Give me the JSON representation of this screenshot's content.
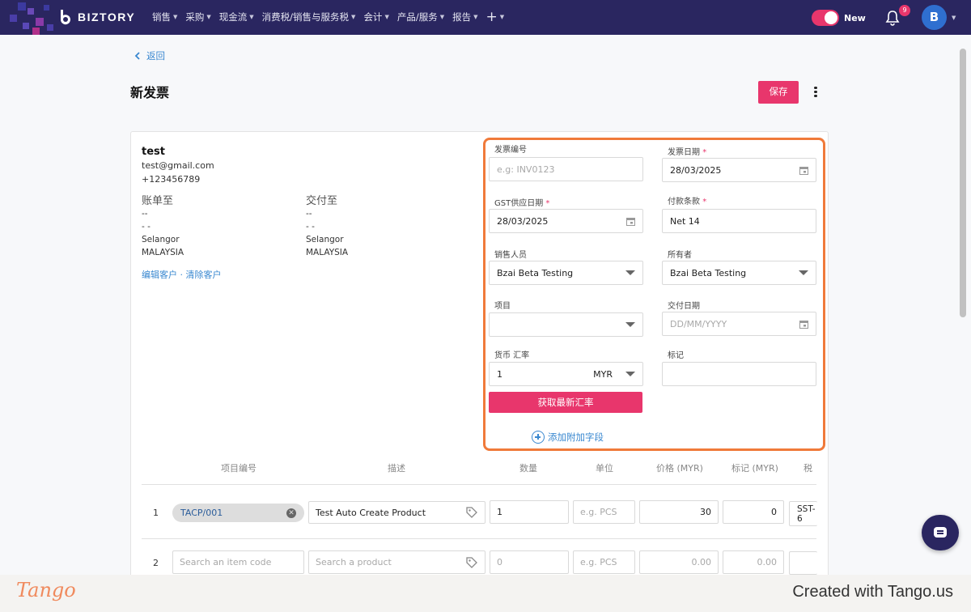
{
  "nav": {
    "brand": "BIZTORY",
    "items": [
      "销售",
      "采购",
      "现金流",
      "消费税/销售与服务税",
      "会计",
      "产品/服务",
      "报告",
      "+"
    ],
    "toggle_label": "New",
    "notification_count": "9",
    "avatar_initial": "B",
    "toggle_on": true
  },
  "header": {
    "back": "返回",
    "title": "新发票",
    "save": "保存"
  },
  "customer": {
    "name": "test",
    "email": "test@gmail.com",
    "phone": "+123456789",
    "billing": {
      "heading": "账单至",
      "line1": "--",
      "line2": "- -",
      "state": "Selangor",
      "country": "MALAYSIA"
    },
    "shipping": {
      "heading": "交付至",
      "line1": "--",
      "line2": "- -",
      "state": "Selangor",
      "country": "MALAYSIA"
    },
    "links": "编辑客户 · 清除客户"
  },
  "form": {
    "invoice_no": {
      "label": "发票编号",
      "placeholder": "e.g: INV0123",
      "value": ""
    },
    "invoice_date": {
      "label": "发票日期",
      "value": "28/03/2025"
    },
    "gst_date": {
      "label": "GST供应日期",
      "value": "28/03/2025"
    },
    "payment_terms": {
      "label": "付款条款",
      "value": "Net 14"
    },
    "salesperson": {
      "label": "销售人员",
      "value": "Bzai Beta Testing"
    },
    "owner": {
      "label": "所有者",
      "value": "Bzai Beta Testing"
    },
    "project": {
      "label": "项目",
      "value": ""
    },
    "delivery_date": {
      "label": "交付日期",
      "placeholder": "DD/MM/YYYY"
    },
    "currency": {
      "label": "货币 汇率",
      "rate": "1",
      "code": "MYR"
    },
    "tags": {
      "label": "标记",
      "value": ""
    },
    "fetch_rate": "获取最新汇率",
    "add_field": "添加附加字段"
  },
  "table": {
    "headers": [
      "项目编号",
      "描述",
      "数量",
      "单位",
      "价格 (MYR)",
      "标记 (MYR)",
      "税"
    ],
    "rows": [
      {
        "num": "1",
        "code": "TACP/001",
        "desc": "Test Auto Create Product",
        "qty": "1",
        "unit_ph": "e.g. PCS",
        "price": "30",
        "markup": "0",
        "tax": "SST-6"
      },
      {
        "num": "2",
        "code_ph": "Search an item code",
        "desc_ph": "Search a product",
        "qty_ph": "0",
        "unit_ph": "e.g. PCS",
        "price_ph": "0.00",
        "markup_ph": "0.00",
        "tax": ""
      }
    ]
  },
  "footer": {
    "logo": "Tango",
    "credit": "Created with Tango.us"
  },
  "colors": {
    "nav_bg": "#2a2660",
    "accent": "#e8366c",
    "link": "#3a88d0",
    "highlight": "#f07a3a"
  }
}
